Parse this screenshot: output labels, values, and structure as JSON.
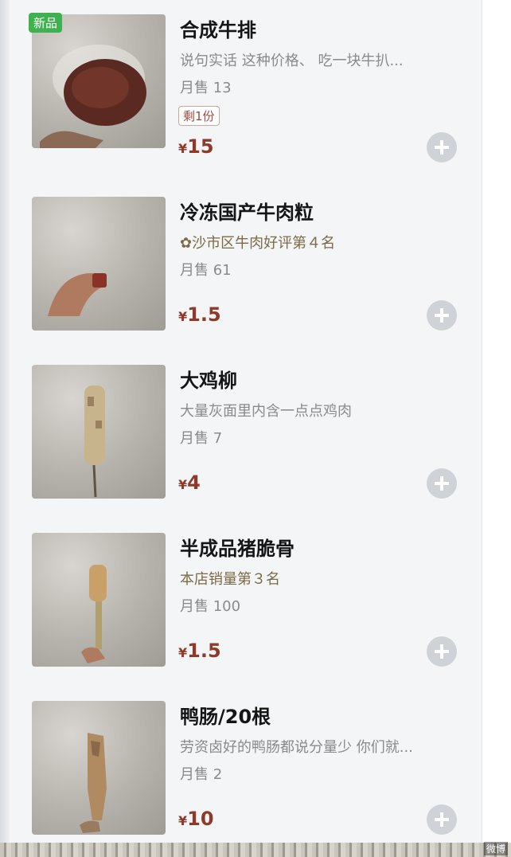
{
  "items": [
    {
      "title": "合成牛排",
      "desc": "说句实话 这种价格、 吃一块牛扒...",
      "sales": "月售 13",
      "badge": "新品",
      "stock": "剩1份",
      "currency": "¥",
      "price": "15"
    },
    {
      "title": "冷冻国产牛肉粒",
      "desc": "沙市区牛肉好评第４名",
      "desc_icon": "medal-icon",
      "sales": "月售 61",
      "currency": "¥",
      "price": "1.5"
    },
    {
      "title": "大鸡柳",
      "desc": "大量灰面里内含一点点鸡肉",
      "sales": "月售 7",
      "currency": "¥",
      "price": "4"
    },
    {
      "title": "半成品猪脆骨",
      "desc": "本店销量第３名",
      "sales": "月售 100",
      "currency": "¥",
      "price": "1.5"
    },
    {
      "title": "鸭肠/20根",
      "desc": "劳资卤好的鸭肠都说分量少 你们就...",
      "sales": "月售 2",
      "currency": "¥",
      "price": "10"
    }
  ],
  "watermark": "微博",
  "colors": {
    "price": "#8e3a2b",
    "badge_new": "#3fb14f",
    "add_button": "#cfd2d6"
  }
}
